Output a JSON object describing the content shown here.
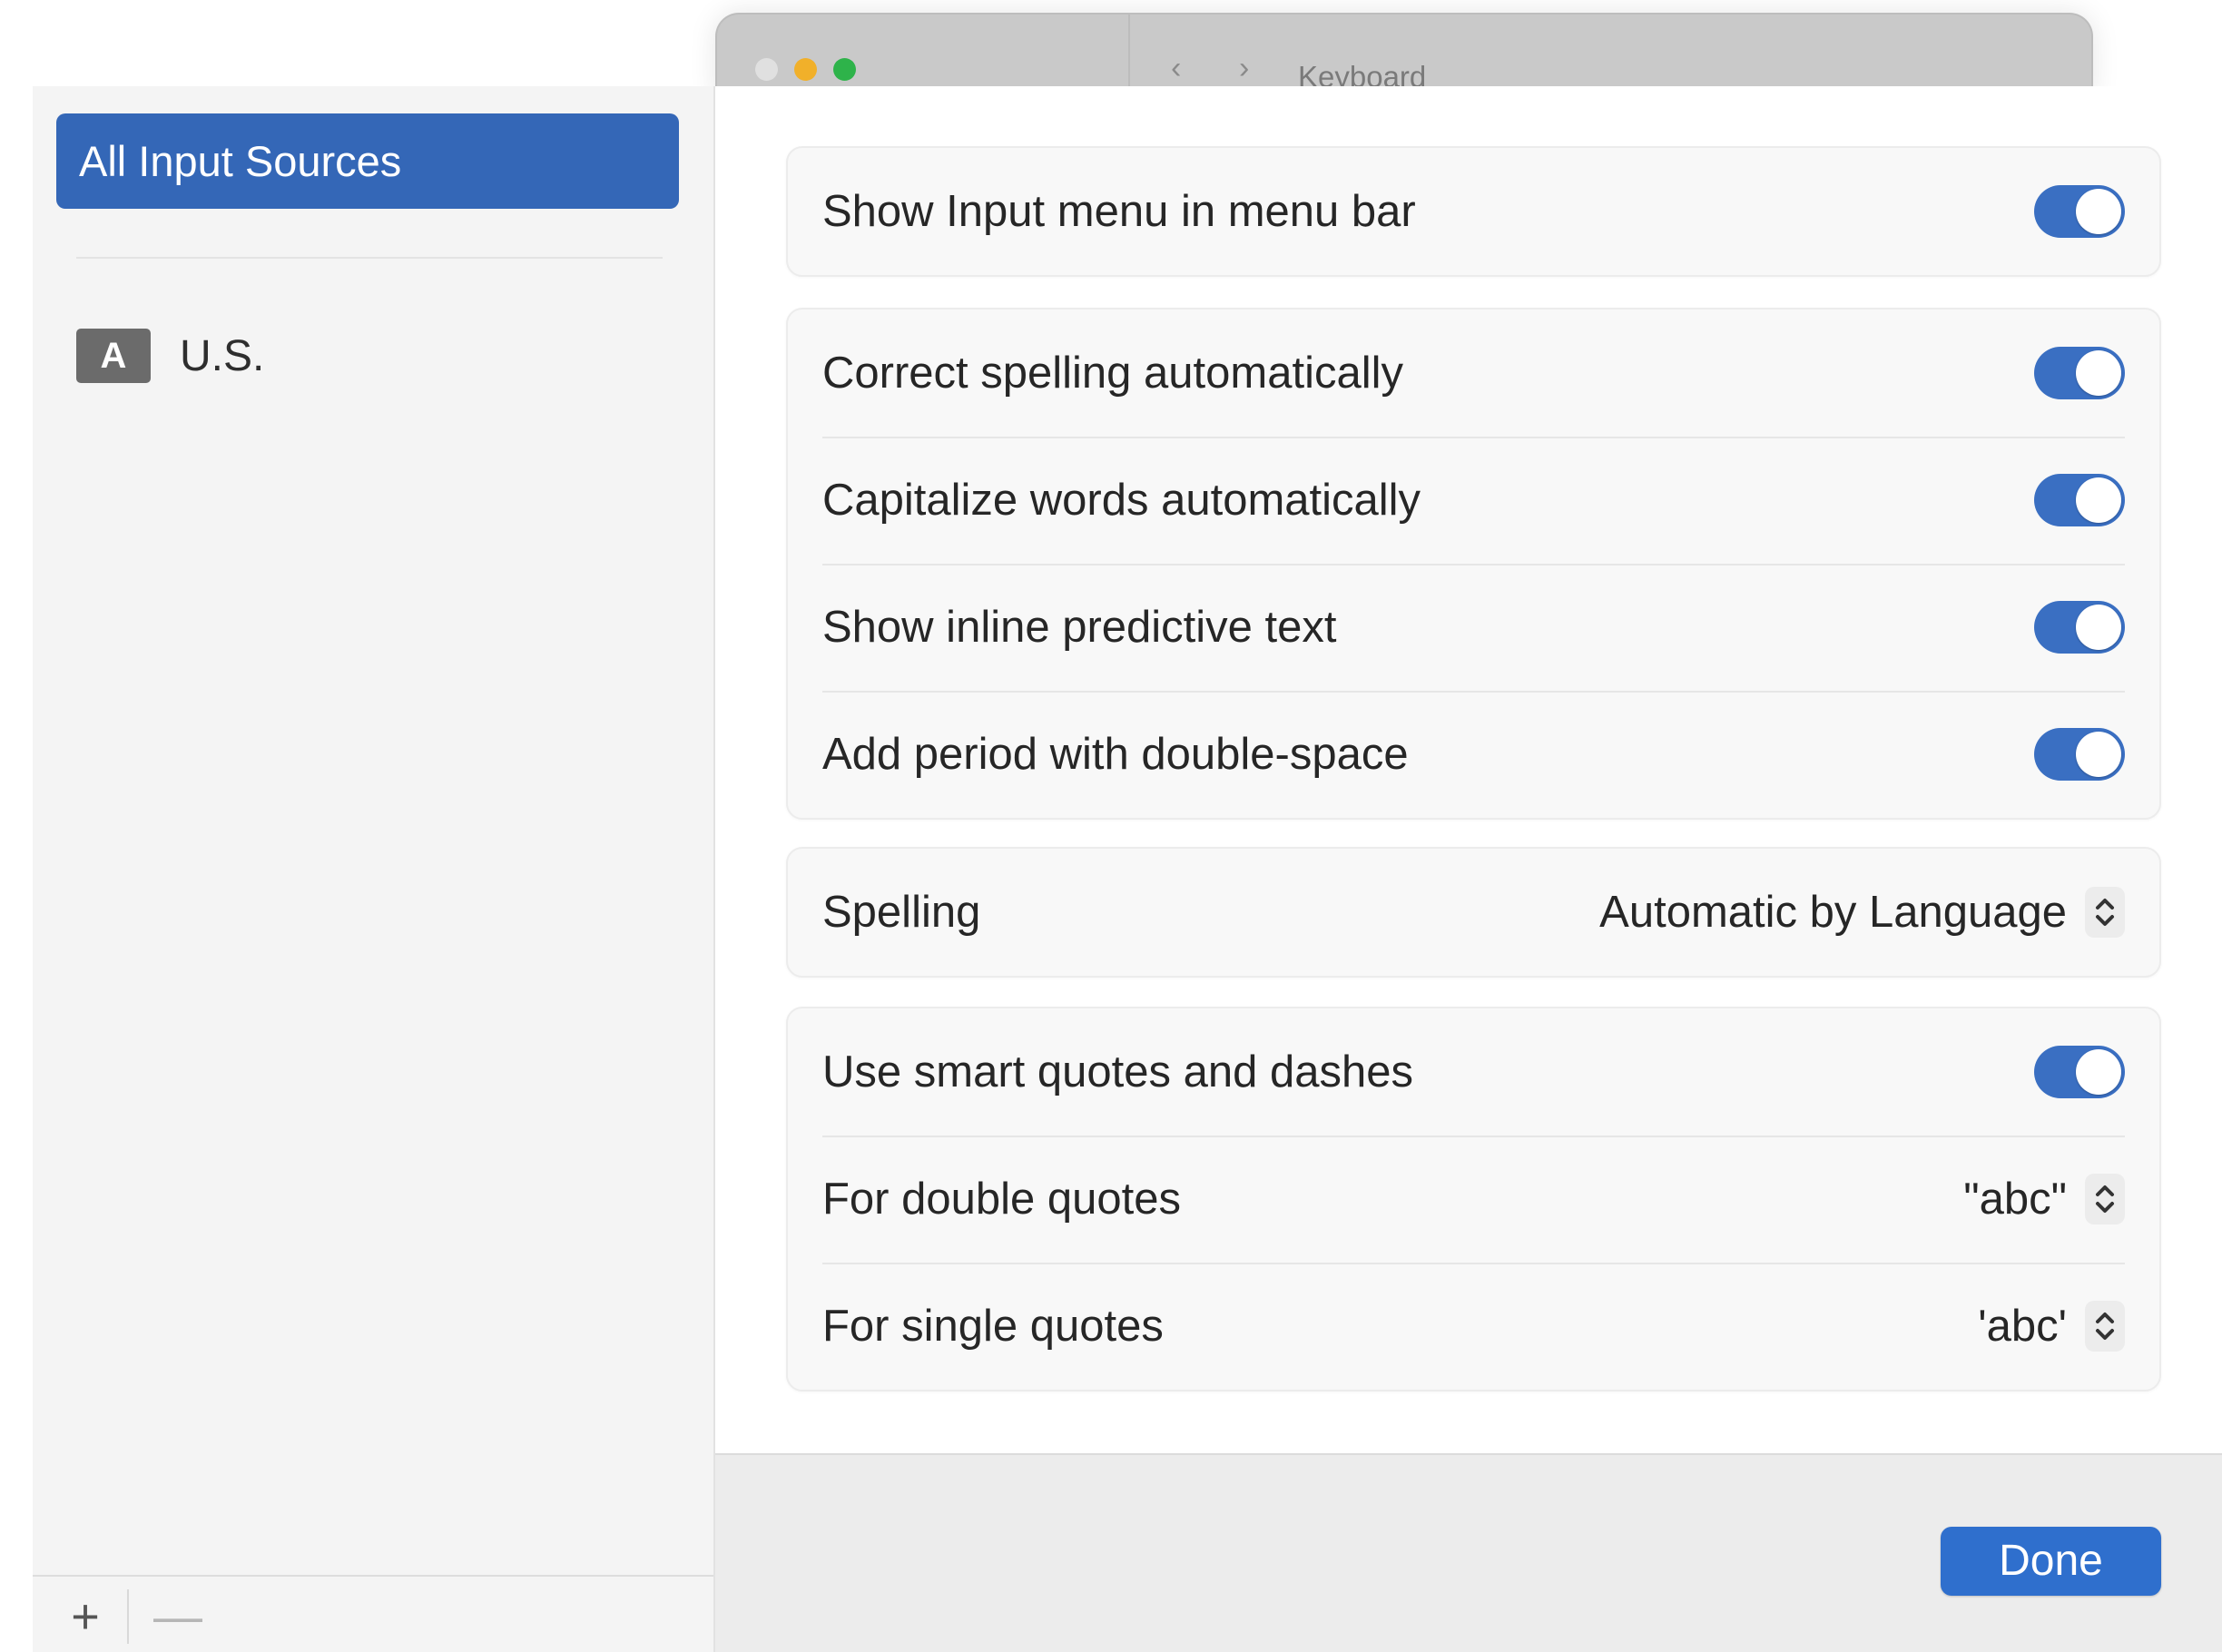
{
  "window": {
    "title": "Keyboard"
  },
  "sidebar": {
    "selected_label": "All Input Sources",
    "sources": [
      {
        "badge": "A",
        "label": "U.S."
      }
    ],
    "add_label": "+",
    "remove_label": "—"
  },
  "groups": {
    "menu": {
      "show_input_menu": {
        "label": "Show Input menu in menu bar",
        "on": true
      }
    },
    "typing": [
      {
        "label": "Correct spelling automatically",
        "on": true
      },
      {
        "label": "Capitalize words automatically",
        "on": true
      },
      {
        "label": "Show inline predictive text",
        "on": true
      },
      {
        "label": "Add period with double-space",
        "on": true
      }
    ],
    "spelling": {
      "label": "Spelling",
      "value": "Automatic by Language"
    },
    "quotes": {
      "smart": {
        "label": "Use smart quotes and dashes",
        "on": true
      },
      "double": {
        "label": "For double quotes",
        "value": "\"abc\""
      },
      "single": {
        "label": "For single quotes",
        "value": "'abc'"
      }
    }
  },
  "footer": {
    "done_label": "Done"
  },
  "colors": {
    "accent": "#3467b7",
    "toggle_on": "#3a6fc2",
    "done_button": "#2f6fcd"
  }
}
